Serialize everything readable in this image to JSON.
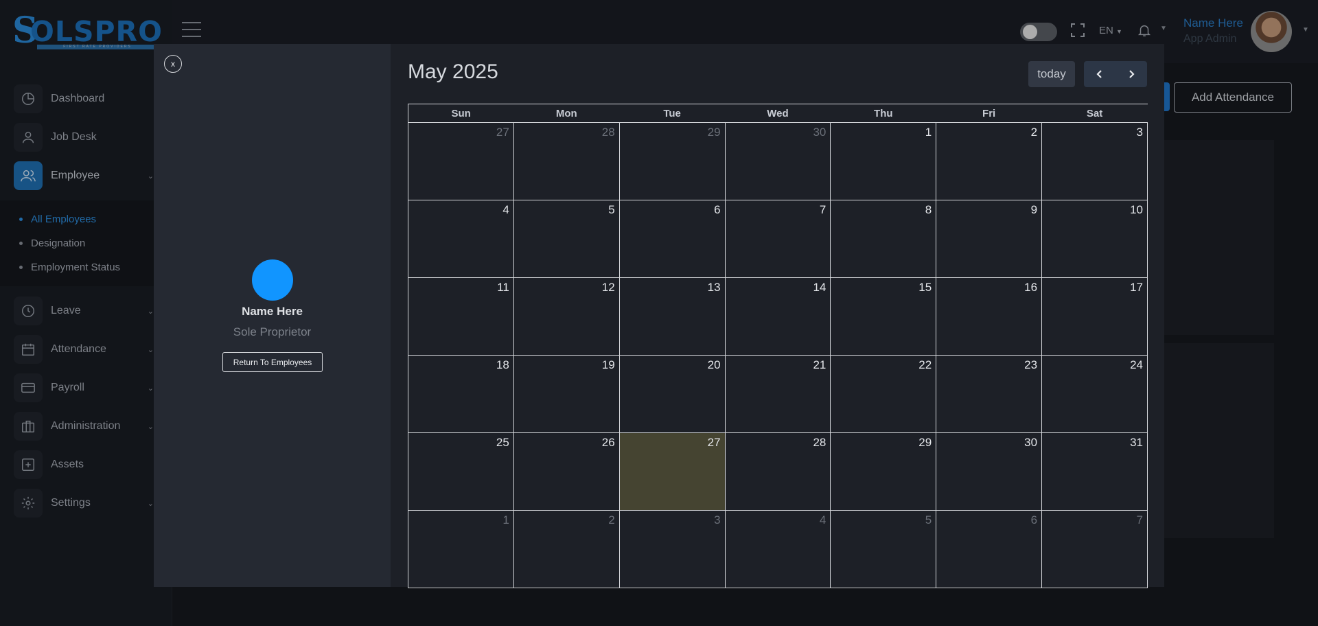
{
  "brand": {
    "logo_text": "OLSPRO",
    "tagline": "FIRST RATE PROVIDERS"
  },
  "sidebar": {
    "items": [
      {
        "label": "Dashboard",
        "icon": "dashboard-icon"
      },
      {
        "label": "Job Desk",
        "icon": "user-icon"
      },
      {
        "label": "Employee",
        "icon": "users-icon",
        "active": true
      },
      {
        "label": "Leave",
        "icon": "clock-icon"
      },
      {
        "label": "Attendance",
        "icon": "calendar-icon"
      },
      {
        "label": "Payroll",
        "icon": "credit-card-icon"
      },
      {
        "label": "Administration",
        "icon": "briefcase-icon"
      },
      {
        "label": "Assets",
        "icon": "plus-square-icon"
      },
      {
        "label": "Settings",
        "icon": "gear-icon"
      }
    ],
    "employee_subitems": [
      {
        "label": "All Employees",
        "active": true
      },
      {
        "label": "Designation"
      },
      {
        "label": "Employment Status"
      }
    ]
  },
  "header": {
    "language": "EN",
    "user_name": "Name Here",
    "user_role": "App Admin"
  },
  "page": {
    "add_attendance_label": "Add Attendance"
  },
  "modal": {
    "close_label": "x",
    "profile": {
      "name": "Name Here",
      "role": "Sole Proprietor",
      "return_label": "Return To Employees"
    },
    "calendar": {
      "title": "May 2025",
      "today_label": "today",
      "weekdays": [
        "Sun",
        "Mon",
        "Tue",
        "Wed",
        "Thu",
        "Fri",
        "Sat"
      ],
      "weeks": [
        [
          "27",
          "28",
          "29",
          "30",
          "1",
          "2",
          "3"
        ],
        [
          "4",
          "5",
          "6",
          "7",
          "8",
          "9",
          "10"
        ],
        [
          "11",
          "12",
          "13",
          "14",
          "15",
          "16",
          "17"
        ],
        [
          "18",
          "19",
          "20",
          "21",
          "22",
          "23",
          "24"
        ],
        [
          "25",
          "26",
          "27",
          "28",
          "29",
          "30",
          "31"
        ],
        [
          "1",
          "2",
          "3",
          "4",
          "5",
          "6",
          "7"
        ]
      ],
      "other_month": [
        [
          0,
          0
        ],
        [
          0,
          1
        ],
        [
          0,
          2
        ],
        [
          0,
          3
        ],
        [
          5,
          0
        ],
        [
          5,
          1
        ],
        [
          5,
          2
        ],
        [
          5,
          3
        ],
        [
          5,
          4
        ],
        [
          5,
          5
        ],
        [
          5,
          6
        ]
      ],
      "today_cell": [
        4,
        2
      ],
      "today_color": "#454431"
    }
  },
  "colors": {
    "accent": "#1f6fb2",
    "profile_avatar": "#1195ff",
    "brand": "#1c6fb8"
  }
}
